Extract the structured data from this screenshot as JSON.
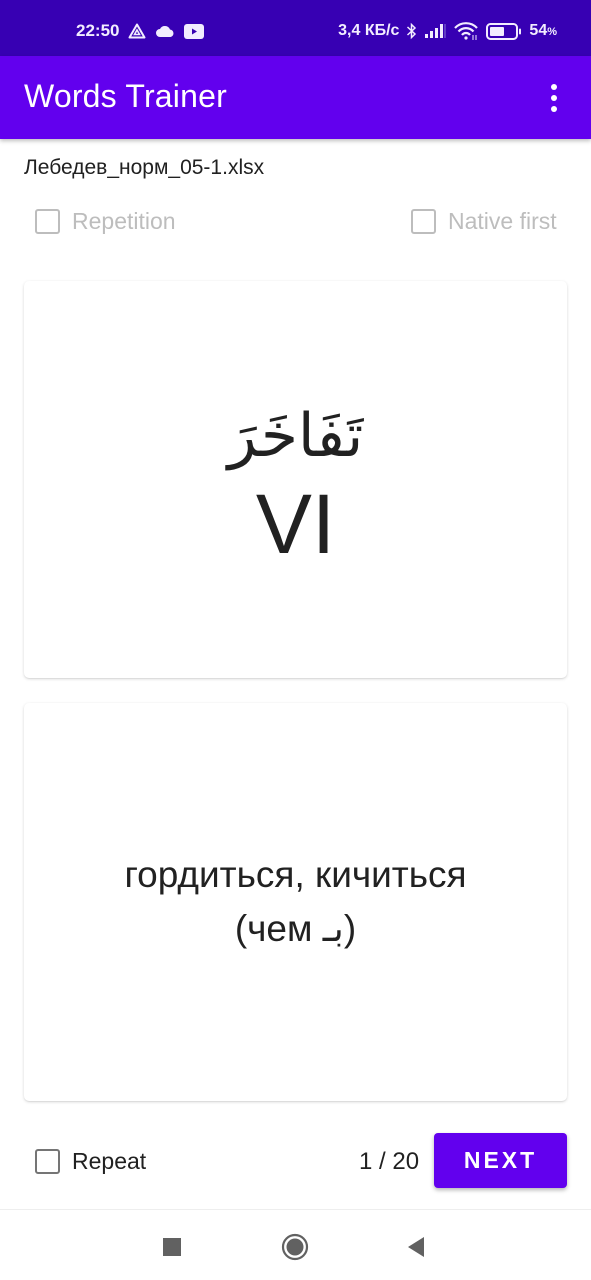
{
  "status_bar": {
    "time": "22:50",
    "left_icons": [
      "delta-triangle-icon",
      "cloud-icon",
      "youtube-icon"
    ],
    "network_speed": "3,4 КБ/с",
    "right_icons": [
      "bluetooth-icon",
      "signal-icon",
      "wifi-icon",
      "battery-icon"
    ],
    "battery_percent": "54",
    "battery_symbol": "%",
    "battery_level": 0.54
  },
  "app_bar": {
    "title": "Words Trainer",
    "menu_icon": "more-vert-icon"
  },
  "file_name": "Лебедев_норм_05-1.xlsx",
  "options": {
    "repetition": {
      "label": "Repetition",
      "checked": false,
      "enabled": false
    },
    "native_first": {
      "label": "Native first",
      "checked": false,
      "enabled": false
    }
  },
  "card_foreign": {
    "word": "تَفَاخَرَ",
    "form": "VI"
  },
  "card_native": {
    "translation_line1": "гордиться, кичиться",
    "translation_line2": "(чем بـ)"
  },
  "footer": {
    "repeat": {
      "label": "Repeat",
      "checked": false
    },
    "counter": "1 / 20",
    "next_label": "NEXT"
  },
  "nav_bar": {
    "buttons": [
      "recents-icon",
      "home-icon",
      "back-icon"
    ]
  },
  "colors": {
    "status_bar": "#3700b3",
    "primary": "#6200ee",
    "disabled_text": "#bdbdbd"
  }
}
